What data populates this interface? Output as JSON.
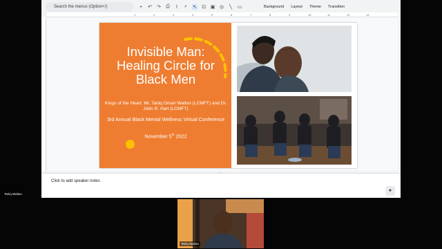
{
  "search": {
    "placeholder": "Search the menus (Option+/)"
  },
  "toolbar": {
    "icons": [
      "plus-icon",
      "undo-icon",
      "redo-icon",
      "print-icon",
      "paint-format-icon",
      "zoom-icon",
      "cursor-icon",
      "textbox-icon",
      "image-icon",
      "shapes-icon",
      "line-icon",
      "comment-icon"
    ],
    "background_label": "Background",
    "layout_label": "Layout",
    "theme_label": "Theme",
    "transition_label": "Transition"
  },
  "ruler": {
    "ticks": [
      "1",
      "2",
      "3",
      "4",
      "5",
      "6",
      "7",
      "8",
      "9",
      "10",
      "11",
      "12",
      "13"
    ]
  },
  "slide": {
    "title": "Invisible Man: Healing Circle for Black Men",
    "presenters": "Kings of the Heart: Mr. Tariiq Omari Walton (LCMFT) and Dr. John R. Hart (LCMFT)",
    "event": "3rd Annual Black Mental Wellness Virtual Conference",
    "date_prefix": "November 5",
    "date_sup": "th",
    "date_year": "2022",
    "colors": {
      "accent_orange": "#ee7d31",
      "dot_yellow": "#ffc000"
    }
  },
  "notes": {
    "placeholder": "Click to add speaker notes"
  },
  "participants": {
    "small_label": "Tariiq Walton",
    "tile_label": "Tariiq Walton"
  }
}
